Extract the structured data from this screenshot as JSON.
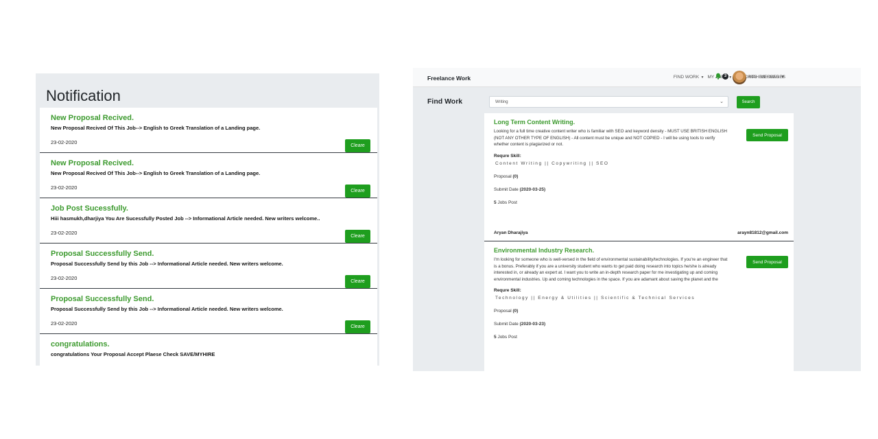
{
  "notifications": {
    "title": "Notification",
    "clear_label": "Cleare",
    "items": [
      {
        "title": "New Proposal Recived.",
        "message": "New Proposal Recived Of This Job--> English to Greek Translation of a Landing page.",
        "date": "23-02-2020"
      },
      {
        "title": "New Proposal Recived.",
        "message": "New Proposal Recived Of This Job--> English to Greek Translation of a Landing page.",
        "date": "23-02-2020"
      },
      {
        "title": "Job Post Sucessfully.",
        "message": "Hiii hasmukh,dharjiya You Are Sucessfully Posted Job --> Informational Article needed. New writers welcome..",
        "date": "23-02-2020"
      },
      {
        "title": "Proposal Successfully Send.",
        "message": "Proposal Successfully Send by this Job --> Informational Article needed. New writers welcome.",
        "date": "23-02-2020"
      },
      {
        "title": "Proposal Successfully Send.",
        "message": "Proposal Successfully Send by this Job --> Informational Article needed. New writers welcome.",
        "date": "23-02-2020"
      },
      {
        "title": "congratulations.",
        "message": "congratulations Your Proposal Accept Plaese Check SAVE/MYHIRE",
        "date": ""
      }
    ]
  },
  "navbar": {
    "brand": "Freelance Work",
    "find_work": "FIND WORK",
    "my_jobs": "MY JOBS",
    "reports": "REPORTS",
    "messages": "MESSAGES",
    "notification_count": "3",
    "user_name": "MAHESH MER",
    "icons": [
      "bell-icon",
      "caret-down-icon",
      "avatar"
    ]
  },
  "find_work": {
    "title": "Find Work",
    "search_value": "Writing",
    "search_button": "Search",
    "send_proposal_label": "Send Proposal",
    "require_skill_label": "Requre Skill:",
    "proposal_label": "Proposal",
    "submit_date_label": "Submit Date",
    "jobs_post_label": "Jobs Post",
    "jobs": [
      {
        "title": "Long Term Content Writing.",
        "description": "Looking for a full time creative content writer who is familiar with SEO and keyword density - MUST USE BRITISH ENGLISH (NOT ANY OTHER TYPE OF ENGLISH) - All content must be unique and NOT COPIED - I will be using tools to verify whether content is plagiarized or not.",
        "skills": "Content Writing || Copywriting || SEO",
        "proposal": "(0)",
        "submit_date": "(2020-03-25)",
        "jobs_post": "5",
        "poster_name": "Aryan Dharajiya",
        "poster_email": "arayn81812@gmail.com"
      },
      {
        "title": "Environmental Industry Research.",
        "description": "I'm looking for someone who is well-versed in the field of environmental sustainability/technologies. If you're an engineer that is a bonus. Preferably if you are a university student who wants to get paid doing research into topics he/she is already interested in, or already an expert at. I want you to write an in-depth research paper for me investigating up and coming environmental industries. Up and coming technologies in the space. If you are adamant about saving the planet and the",
        "skills": "Technology || Energy & Utilities || Scientific & Technical Services",
        "proposal": "(0)",
        "submit_date": "(2020-03-23)",
        "jobs_post": "5"
      }
    ]
  }
}
